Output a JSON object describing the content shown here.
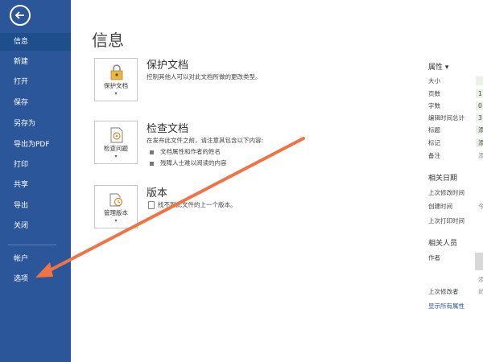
{
  "sidebar": {
    "items": [
      {
        "label": "信息"
      },
      {
        "label": "新建"
      },
      {
        "label": "打开"
      },
      {
        "label": "保存"
      },
      {
        "label": "另存为"
      },
      {
        "label": "导出为PDF"
      },
      {
        "label": "打印"
      },
      {
        "label": "共享"
      },
      {
        "label": "导出"
      },
      {
        "label": "关闭"
      },
      {
        "label": "帐户"
      },
      {
        "label": "选项"
      }
    ]
  },
  "main": {
    "title": "信息",
    "protect": {
      "tile_label": "保护文档",
      "title": "保护文档",
      "desc": "控制其他人可以对此文档所做的更改类型。"
    },
    "inspect": {
      "tile_label": "检查问题",
      "title": "检查文档",
      "desc": "在发布此文件之前，请注意其包含以下内容:",
      "bullets": [
        "文档属性和作者的姓名",
        "残障人士难以阅读的内容"
      ]
    },
    "version": {
      "tile_label": "管理版本",
      "title": "版本",
      "desc": "找不到此文件的上一个版本。"
    }
  },
  "properties": {
    "title": "属性",
    "rows": [
      {
        "label": "大小",
        "value": ""
      },
      {
        "label": "页数",
        "value": "1"
      },
      {
        "label": "字数",
        "value": "0"
      },
      {
        "label": "编辑时间总计",
        "value": "3"
      },
      {
        "label": "标题",
        "value": "添"
      },
      {
        "label": "标记",
        "value": "添"
      },
      {
        "label": "备注",
        "value": "添"
      }
    ],
    "dates_title": "相关日期",
    "dates": [
      {
        "label": "上次修改时间",
        "value": ""
      },
      {
        "label": "创建时间",
        "value": "今"
      },
      {
        "label": "上次打印时间",
        "value": ""
      }
    ],
    "people_title": "相关人员",
    "author_label": "作者",
    "author_add": "添",
    "last_modified_by_label": "上次修改者",
    "last_modified_by_value": "尚",
    "show_all": "显示所有属性"
  },
  "colors": {
    "sidebar": "#2b579a",
    "annotation_arrow": "#f07346"
  }
}
